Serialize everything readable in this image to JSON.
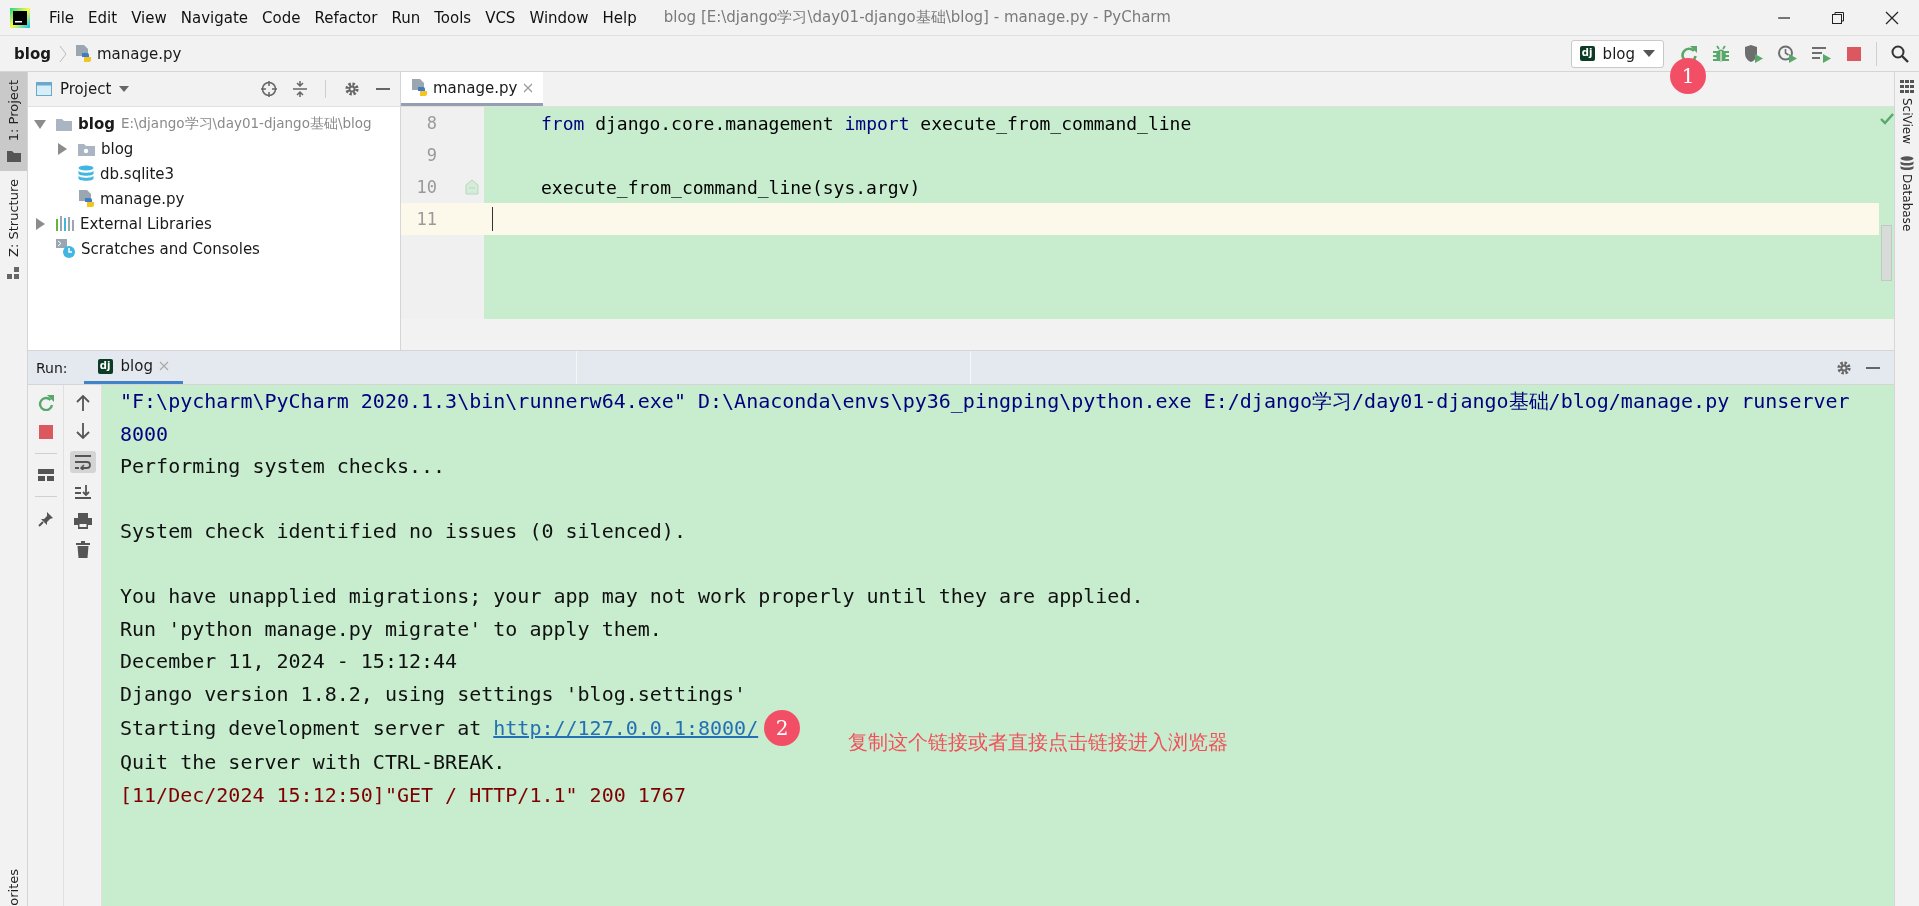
{
  "window": {
    "title": "blog [E:\\django学习\\day01-django基础\\blog] - manage.py - PyCharm"
  },
  "menu": [
    "File",
    "Edit",
    "View",
    "Navigate",
    "Code",
    "Refactor",
    "Run",
    "Tools",
    "VCS",
    "Window",
    "Help"
  ],
  "breadcrumb": [
    "blog",
    "manage.py"
  ],
  "run_config": {
    "icon_text": "dj",
    "label": "blog",
    "badge": "1"
  },
  "left_strip": [
    {
      "label": "1: Project",
      "selected": true,
      "kind": "project"
    },
    {
      "label": "Z: Structure",
      "selected": false,
      "kind": "structure"
    }
  ],
  "left_strip_bottom": {
    "label": "orites"
  },
  "right_strip": [
    {
      "label": "SciView",
      "kind": "sciview"
    },
    {
      "label": "Database",
      "kind": "database"
    }
  ],
  "project": {
    "title": "Project",
    "tree": [
      {
        "label": "blog",
        "kind": "root",
        "path": "E:\\django学习\\day01-django基础\\blog",
        "expanded": true,
        "children": [
          {
            "label": "blog",
            "kind": "folder",
            "expanded": false
          },
          {
            "label": "db.sqlite3",
            "kind": "database"
          },
          {
            "label": "manage.py",
            "kind": "python"
          }
        ]
      },
      {
        "label": "External Libraries",
        "kind": "libraries",
        "expanded": false
      },
      {
        "label": "Scratches and Consoles",
        "kind": "scratches"
      }
    ]
  },
  "editor": {
    "tabs": [
      {
        "label": "manage.py",
        "selected": true
      }
    ],
    "lines": [
      {
        "number": "8",
        "current": false,
        "fold": false,
        "tokens": [
          {
            "kind": "keyword",
            "text": "from"
          },
          {
            "kind": "plain",
            "text": " django.core.management "
          },
          {
            "kind": "keyword",
            "text": "import"
          },
          {
            "kind": "plain",
            "text": " execute_from_command_line"
          }
        ]
      },
      {
        "number": "9",
        "current": false,
        "fold": false
      },
      {
        "number": "10",
        "current": false,
        "fold": true,
        "tokens": [
          {
            "kind": "plain",
            "text": "execute_from_command_line(sys.argv)"
          }
        ]
      },
      {
        "number": "11",
        "current": true,
        "fold": false
      }
    ]
  },
  "run": {
    "title": "Run:",
    "tabs": [
      {
        "icon_text": "dj",
        "label": "blog",
        "selected": true
      }
    ],
    "lines": [
      {
        "kind": "command",
        "text": "\"F:\\pycharm\\PyCharm 2020.1.3\\bin\\runnerw64.exe\" D:\\Anaconda\\envs\\py36_pingping\\python.exe E:/django学习/day01-django基础/blog/manage.py runserver 8000"
      },
      {
        "kind": "normal",
        "text": "Performing system checks..."
      },
      {
        "kind": "blank"
      },
      {
        "kind": "normal",
        "text": "System check identified no issues (0 silenced)."
      },
      {
        "kind": "blank"
      },
      {
        "kind": "normal",
        "text": "You have unapplied migrations; your app may not work properly until they are applied."
      },
      {
        "kind": "normal",
        "text": "Run 'python manage.py migrate' to apply them."
      },
      {
        "kind": "normal",
        "text": "December 11, 2024 - 15:12:44"
      },
      {
        "kind": "normal",
        "text": "Django version 1.8.2, using settings 'blog.settings'"
      },
      {
        "kind": "link",
        "text": "Starting development server at ",
        "link": "http://127.0.0.1:8000/",
        "badge": "2",
        "note": "复制这个链接或者直接点击链接进入浏览器"
      },
      {
        "kind": "normal",
        "text": "Quit the server with CTRL-BREAK."
      },
      {
        "kind": "error",
        "text": "[11/Dec/2024 15:12:50]\"GET / HTTP/1.1\" 200 1767"
      }
    ]
  }
}
